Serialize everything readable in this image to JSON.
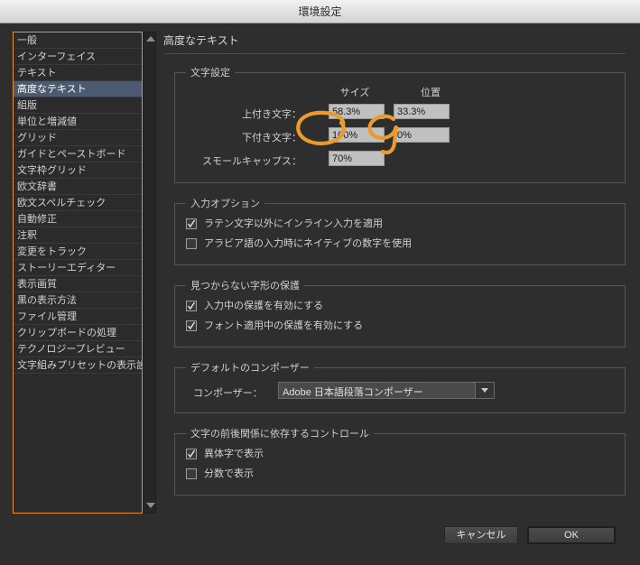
{
  "window": {
    "title": "環境設定"
  },
  "sidebar": {
    "items": [
      {
        "label": "一般",
        "selected": false
      },
      {
        "label": "インターフェイス",
        "selected": false
      },
      {
        "label": "テキスト",
        "selected": false
      },
      {
        "label": "高度なテキスト",
        "selected": true
      },
      {
        "label": "組版",
        "selected": false
      },
      {
        "label": "単位と増減値",
        "selected": false
      },
      {
        "label": "グリッド",
        "selected": false
      },
      {
        "label": "ガイドとペーストボード",
        "selected": false
      },
      {
        "label": "文字枠グリッド",
        "selected": false
      },
      {
        "label": "欧文辞書",
        "selected": false
      },
      {
        "label": "欧文スペルチェック",
        "selected": false
      },
      {
        "label": "自動修正",
        "selected": false
      },
      {
        "label": "注釈",
        "selected": false
      },
      {
        "label": "変更をトラック",
        "selected": false
      },
      {
        "label": "ストーリーエディター",
        "selected": false
      },
      {
        "label": "表示画質",
        "selected": false
      },
      {
        "label": "黒の表示方法",
        "selected": false
      },
      {
        "label": "ファイル管理",
        "selected": false
      },
      {
        "label": "クリップボードの処理",
        "selected": false
      },
      {
        "label": "テクノロジープレビュー",
        "selected": false
      },
      {
        "label": "文字組みプリセットの表示設定",
        "selected": false
      }
    ],
    "scroll_up_icon": "triangle-up-icon",
    "scroll_down_icon": "triangle-down-icon"
  },
  "panel": {
    "title": "高度なテキスト",
    "character_settings": {
      "legend": "文字設定",
      "col_size": "サイズ",
      "col_position": "位置",
      "rows": [
        {
          "label": "上付き文字：",
          "size": "58.3%",
          "position": "33.3%"
        },
        {
          "label": "下付き文字：",
          "size": "100%",
          "position": "0%"
        },
        {
          "label": "スモールキャップス：",
          "size": "70%",
          "position": null
        }
      ]
    },
    "input_options": {
      "legend": "入力オプション",
      "items": [
        {
          "label": "ラテン文字以外にインライン入力を適用",
          "checked": true
        },
        {
          "label": "アラビア語の入力時にネイティブの数字を使用",
          "checked": false
        }
      ]
    },
    "missing_glyph_protection": {
      "legend": "見つからない字形の保護",
      "items": [
        {
          "label": "入力中の保護を有効にする",
          "checked": true
        },
        {
          "label": "フォント適用中の保護を有効にする",
          "checked": true
        }
      ]
    },
    "default_composer": {
      "legend": "デフォルトのコンポーザー",
      "label": "コンポーザー：",
      "value": "Adobe 日本語段落コンポーザー",
      "arrow_icon": "chevron-down-icon"
    },
    "context_controls": {
      "legend": "文字の前後関係に依存するコントロール",
      "items": [
        {
          "label": "異体字で表示",
          "checked": true
        },
        {
          "label": "分数で表示",
          "checked": false
        }
      ]
    }
  },
  "footer": {
    "cancel_label": "キャンセル",
    "ok_label": "OK"
  },
  "annotations": {
    "color": "#eb9b2d",
    "marks": [
      {
        "name": "circle-around-subscript-size",
        "target": "100%"
      },
      {
        "name": "circle-around-subscript-position",
        "target": "0%"
      }
    ]
  },
  "colors": {
    "accent_orange": "#e8922e",
    "selection_blue": "#4b5a6e",
    "panel_bg": "#2e2e2e",
    "field_bg": "#c0c0c0"
  }
}
